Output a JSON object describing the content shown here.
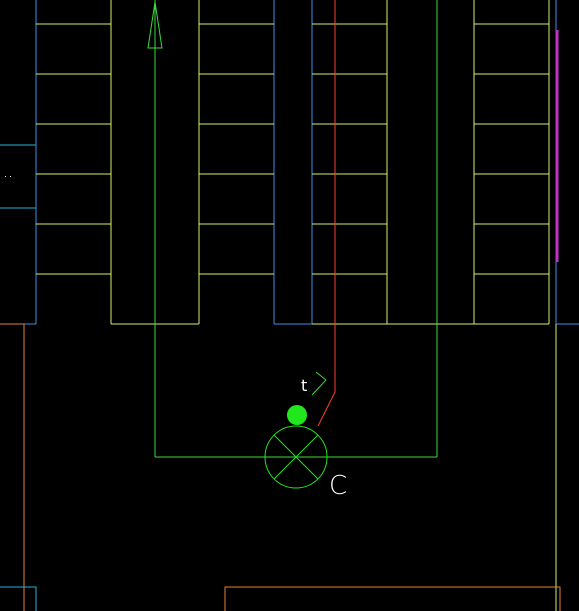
{
  "drawing": {
    "background": "#000000",
    "colors": {
      "aisle_line": "#d2f06a",
      "bay_outline": "#3b8fe6",
      "red_route": "#ff3b2f",
      "green_route": "#22e61e",
      "orange_wall": "#e5813a",
      "magenta_edge": "#c033c7",
      "cyan_box": "#1fb4d6",
      "label": "#ffffff"
    },
    "labels": {
      "t_mark": "t",
      "c_mark": "C"
    },
    "symbols": {
      "flow_arrow": "arrow-up-icon",
      "endpoint": "green-dot-icon",
      "valve": "circle-cross-icon"
    }
  }
}
